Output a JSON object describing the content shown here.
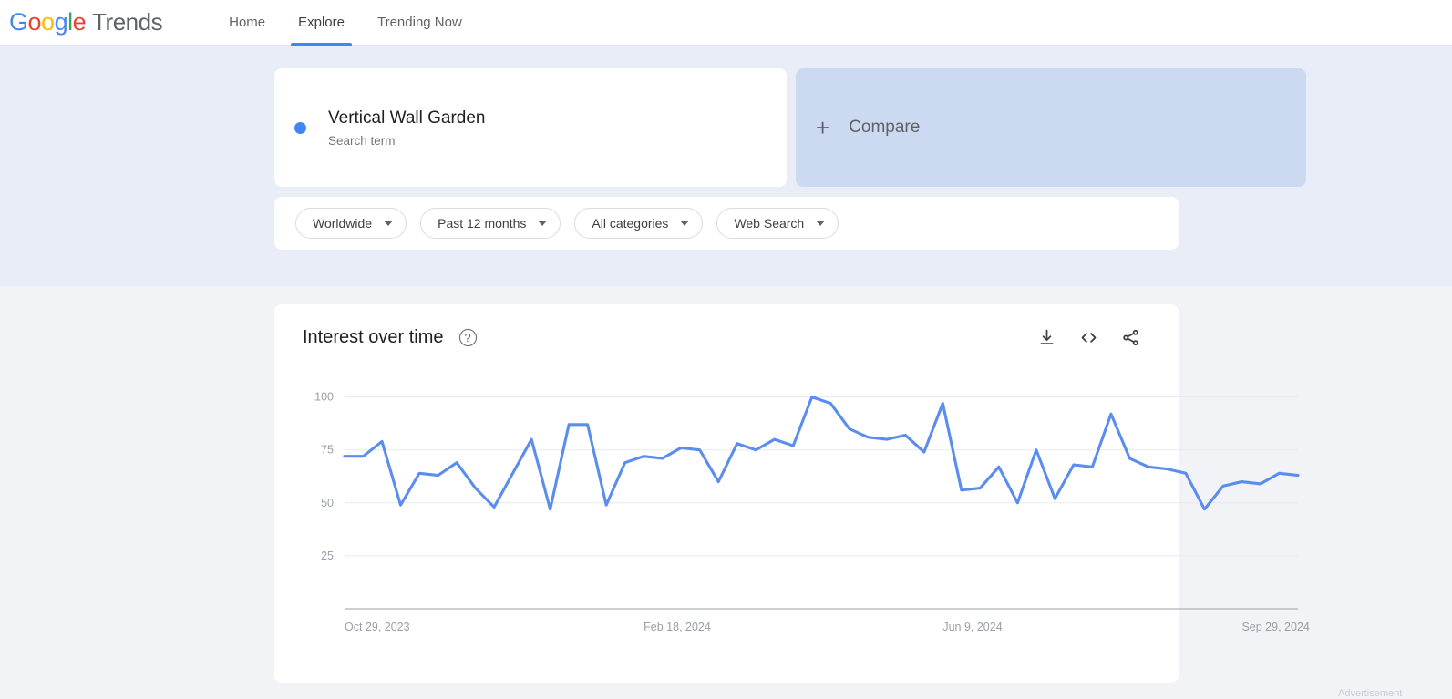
{
  "header": {
    "logo_google": "Google",
    "logo_trends": "Trends",
    "nav": [
      {
        "label": "Home",
        "active": false
      },
      {
        "label": "Explore",
        "active": true
      },
      {
        "label": "Trending Now",
        "active": false
      }
    ]
  },
  "query": {
    "term": {
      "title": "Vertical Wall Garden",
      "subtitle": "Search term",
      "color": "#4285f4"
    },
    "compare": {
      "plus": "+",
      "label": "Compare"
    },
    "filters": [
      {
        "name": "location",
        "label": "Worldwide"
      },
      {
        "name": "time-range",
        "label": "Past 12 months"
      },
      {
        "name": "category",
        "label": "All categories"
      },
      {
        "name": "search-type",
        "label": "Web Search"
      }
    ]
  },
  "chart_panel": {
    "title": "Interest over time",
    "help_glyph": "?",
    "actions": [
      {
        "name": "download-icon",
        "title": "Download"
      },
      {
        "name": "embed-code-icon",
        "title": "Embed"
      },
      {
        "name": "share-icon",
        "title": "Share"
      }
    ]
  },
  "footer_partial": "Advertisement",
  "chart_data": {
    "type": "line",
    "title": "Interest over time",
    "xlabel": "",
    "ylabel": "",
    "ylim": [
      0,
      105
    ],
    "grid": true,
    "legend": false,
    "line_color": "#5b8dee",
    "axis_color": "#9aa0a6",
    "gridline_color": "#e8eaed",
    "y_ticks": [
      100,
      75,
      50,
      25
    ],
    "x_tick_labels": [
      "Oct 29, 2023",
      "Feb 18, 2024",
      "Jun 9, 2024",
      "Sep 29, 2024"
    ],
    "x_tick_indices": [
      0,
      16,
      32,
      48
    ],
    "x": [
      "Oct 29, 2023",
      "Nov 5, 2023",
      "Nov 12, 2023",
      "Nov 19, 2023",
      "Nov 26, 2023",
      "Dec 3, 2023",
      "Dec 10, 2023",
      "Dec 17, 2023",
      "Dec 24, 2023",
      "Dec 31, 2023",
      "Jan 7, 2024",
      "Jan 14, 2024",
      "Jan 21, 2024",
      "Jan 28, 2024",
      "Feb 4, 2024",
      "Feb 11, 2024",
      "Feb 18, 2024",
      "Feb 25, 2024",
      "Mar 3, 2024",
      "Mar 10, 2024",
      "Mar 17, 2024",
      "Mar 24, 2024",
      "Mar 31, 2024",
      "Apr 7, 2024",
      "Apr 14, 2024",
      "Apr 21, 2024",
      "Apr 28, 2024",
      "May 5, 2024",
      "May 12, 2024",
      "May 19, 2024",
      "May 26, 2024",
      "Jun 2, 2024",
      "Jun 9, 2024",
      "Jun 16, 2024",
      "Jun 23, 2024",
      "Jun 30, 2024",
      "Jul 7, 2024",
      "Jul 14, 2024",
      "Jul 21, 2024",
      "Jul 28, 2024",
      "Aug 4, 2024",
      "Aug 11, 2024",
      "Aug 18, 2024",
      "Aug 25, 2024",
      "Sep 1, 2024",
      "Sep 8, 2024",
      "Sep 15, 2024",
      "Sep 22, 2024",
      "Sep 29, 2024",
      "Oct 6, 2024",
      "Oct 13, 2024",
      "Oct 20, 2024"
    ],
    "values": [
      72,
      72,
      79,
      49,
      64,
      63,
      69,
      57,
      48,
      64,
      80,
      47,
      87,
      87,
      49,
      69,
      72,
      71,
      76,
      75,
      60,
      78,
      75,
      80,
      77,
      100,
      97,
      85,
      81,
      80,
      82,
      74,
      97,
      56,
      57,
      67,
      50,
      75,
      52,
      68,
      67,
      92,
      71,
      67,
      66,
      64,
      47,
      58,
      60,
      59,
      64,
      63
    ],
    "series_name": "Vertical Wall Garden"
  }
}
